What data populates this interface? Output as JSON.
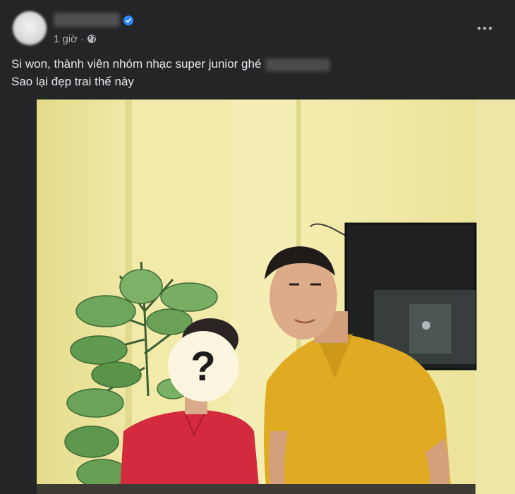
{
  "post": {
    "time": "1 giờ",
    "separator": "·",
    "caption_line1": "Si won, thành viên nhóm nhạc super junior ghé",
    "caption_line2": "Sao lại đẹp trai thế này",
    "more_icon": "ellipsis-icon",
    "privacy_icon": "globe-icon",
    "verified_icon": "verified-badge-icon"
  },
  "photo": {
    "face_overlay_text": "?"
  },
  "colors": {
    "background": "#242526",
    "verified": "#2d88ff",
    "text_primary": "#e4e6eb",
    "text_secondary": "#b0b3b8",
    "wall": "#e9e29a",
    "yellow_shirt": "#e0ab22",
    "red_shirt": "#d42a3e"
  }
}
